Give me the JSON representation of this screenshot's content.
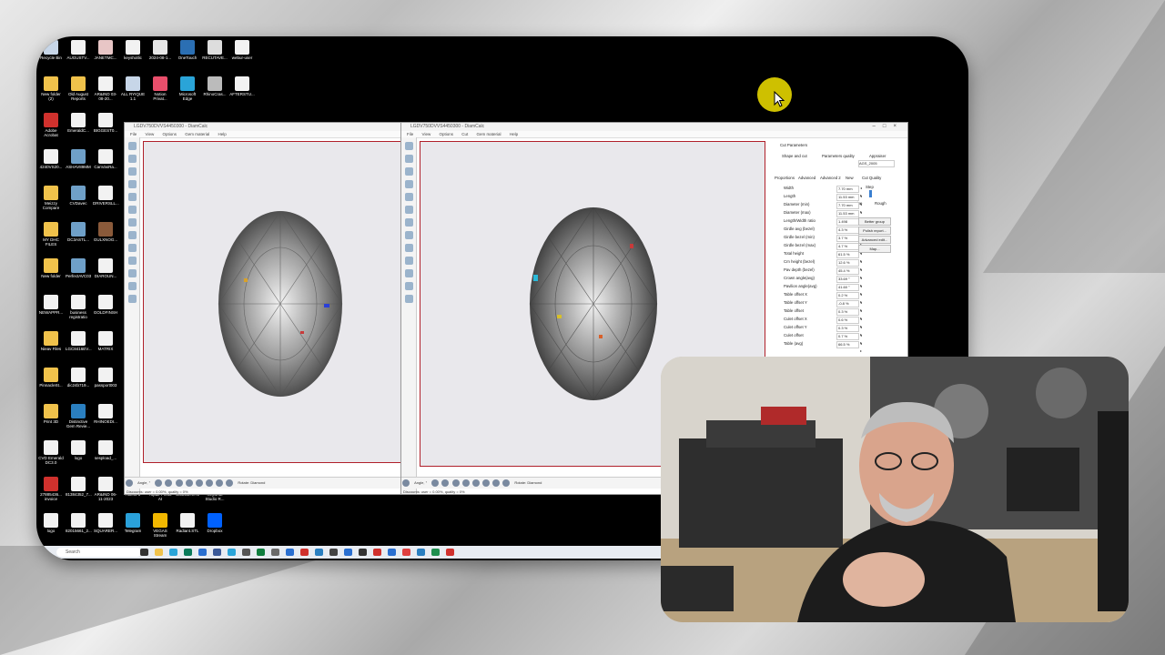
{
  "desktop_icons": [
    {
      "label": "Recycle Bin",
      "color": "#c7d6e8"
    },
    {
      "label": "AUGUSTV...",
      "color": "#f2f2f2"
    },
    {
      "label": "JANETMC...",
      "color": "#e8c6c6"
    },
    {
      "label": "keyshotlic",
      "color": "#f2f2f2"
    },
    {
      "label": "2024-08-1...",
      "color": "#e6e6e6"
    },
    {
      "label": "OneTouch",
      "color": "#2b6fb3"
    },
    {
      "label": "RECUTAVE...",
      "color": "#dddddd"
    },
    {
      "label": "webur-user",
      "color": "#f2f2f2"
    },
    {
      "label": "New folder (2)",
      "color": "#f0c24b"
    },
    {
      "label": "Old August Reports",
      "color": "#f0c24b"
    },
    {
      "label": "AR&IND 03-08-20...",
      "color": "#f2f2f2"
    },
    {
      "label": "ALL RYIQUE 1.1",
      "color": "#c7d6e8"
    },
    {
      "label": "Notion Privat...",
      "color": "#e94e6b"
    },
    {
      "label": "Microsoft Edge",
      "color": "#2aa4d8"
    },
    {
      "label": "RhinoCras...",
      "color": "#bbbbbb"
    },
    {
      "label": "AFTERSTU...",
      "color": "#f2f2f2"
    },
    {
      "label": "Adobe Acrobat",
      "color": "#d0312d"
    },
    {
      "label": "EmeraldC...",
      "color": "#f2f2f2"
    },
    {
      "label": "BIGGEST0...",
      "color": "#f2f2f2"
    },
    {
      "label": "4240VS20...",
      "color": "#f2f2f2"
    },
    {
      "label": "ASHAV89MM",
      "color": "#6fa0c8"
    },
    {
      "label": "CanVasRa...",
      "color": "#f2f2f2"
    },
    {
      "label": "Meizzy Compare",
      "color": "#f0c24b"
    },
    {
      "label": "CVDavec",
      "color": "#6fa0c8"
    },
    {
      "label": "DRIVERSLL...",
      "color": "#f2f2f2"
    },
    {
      "label": "MY DHC FILES",
      "color": "#f0c24b"
    },
    {
      "label": "DC3ASTL...",
      "color": "#6fa0c8"
    },
    {
      "label": "GULXNOG...",
      "color": "#8a5a3a"
    },
    {
      "label": "New folder",
      "color": "#f0c24b"
    },
    {
      "label": "PerfectAVC03",
      "color": "#6fa0c8"
    },
    {
      "label": "DIAROUN...",
      "color": "#f2f2f2"
    },
    {
      "label": "NEWAPPR...",
      "color": "#f2f2f2"
    },
    {
      "label": "business registratio",
      "color": "#f2f2f2"
    },
    {
      "label": "GOLDFINSH",
      "color": "#f2f2f2"
    },
    {
      "label": "Nieav Files",
      "color": "#f0c24b"
    },
    {
      "label": "LGC8416EV...",
      "color": "#f2f2f2"
    },
    {
      "label": "MATRIX",
      "color": "#f2f2f2"
    },
    {
      "label": "PinnacleSt...",
      "color": "#f0c24b"
    },
    {
      "label": "dic24b719...",
      "color": "#f2f2f2"
    },
    {
      "label": "passport003",
      "color": "#f2f2f2"
    },
    {
      "label": "Print 3D",
      "color": "#f0c24b"
    },
    {
      "label": "Distinctive Gem Revie...",
      "color": "#2a7fc0"
    },
    {
      "label": "RHINOEDI...",
      "color": "#f2f2f2"
    },
    {
      "label": "CVD Emerald DC3.0",
      "color": "#f2f2f2"
    },
    {
      "label": "logo",
      "color": "#f2f2f2"
    },
    {
      "label": "sespload_...",
      "color": "#f2f2f2"
    },
    {
      "label": "27885436... invoice",
      "color": "#d0312d"
    },
    {
      "label": "81384352_7...",
      "color": "#f2f2f2"
    },
    {
      "label": "AR&IND 06-11-2023",
      "color": "#f2f2f2"
    },
    {
      "label": "Akeno 8",
      "color": "#f2f2f2"
    },
    {
      "label": "Topaz Photo AI",
      "color": "#f2f2f2"
    },
    {
      "label": "Cushion.STL",
      "color": "#f2f2f2"
    },
    {
      "label": "KeyShot Studio R...",
      "color": "#f2f2f2"
    },
    {
      "label": "logo",
      "color": "#f2f2f2"
    },
    {
      "label": "82015661_2...",
      "color": "#f2f2f2"
    },
    {
      "label": "SQUARER...",
      "color": "#f2f2f2"
    },
    {
      "label": "Telegram",
      "color": "#2aa1da"
    },
    {
      "label": "VEGAS Stream",
      "color": "#f2b800"
    },
    {
      "label": "Radiant.STL",
      "color": "#f2f2f2"
    },
    {
      "label": "Dropbox",
      "color": "#0061fe"
    }
  ],
  "window1": {
    "title": "LGDV750DVVS4450300 - DiamCalc",
    "menu": [
      "File",
      "View",
      "Options",
      "Gem material",
      "Help"
    ],
    "angle_label": "Angle, °",
    "rotate_label": "Rotate: Diamond",
    "status": "Discounts: user = 0.00%, quality = 0%"
  },
  "window2": {
    "title": "LGDV750DVVS4450300 - DiamCalc",
    "menu": [
      "File",
      "View",
      "Options",
      "Cut",
      "Gem material",
      "Help"
    ],
    "angle_label": "Angle, °",
    "rotate_label": "Rotate: Diamond",
    "status": "Discounts: user = 0.00%, quality = 0%"
  },
  "cut_panel": {
    "header": "Cut Parameters",
    "tabs": [
      "Shape and cut",
      "Parameters quality",
      "Appraiser"
    ],
    "appraiser_value": "AGS_2005",
    "subtabs": [
      "Proportions",
      "Advanced",
      "Advanced 2",
      "New"
    ],
    "cut_quality_label": "Cut Quality",
    "cut_quality_top": "Step",
    "fine_label": "Fine",
    "rough_label": "Rough",
    "rows": [
      {
        "label": "Width",
        "value": "7.70 mm"
      },
      {
        "label": "Length",
        "value": "11.53 mm"
      },
      {
        "label": "Diameter (min)",
        "value": "7.70 mm"
      },
      {
        "label": "Diameter (max)",
        "value": "11.53 mm"
      },
      {
        "label": "Length/Width ratio",
        "value": "1.498"
      },
      {
        "label": "Girdle avg (bezel)",
        "value": "4.3 %"
      },
      {
        "label": "Girdle bezel (min)",
        "value": "3.7 %"
      },
      {
        "label": "Girdle bezel (max)",
        "value": "4.7 %"
      },
      {
        "label": "Total height",
        "value": "61.5 %"
      },
      {
        "label": "Crn height (bezel)",
        "value": "12.6 %"
      },
      {
        "label": "Pav depth (bezel)",
        "value": "45.4 %"
      },
      {
        "label": "Crown angle(avg)",
        "value": "33.69 °"
      },
      {
        "label": "Pavilion angle(avg)",
        "value": "41.60 °"
      },
      {
        "label": "Table offset X",
        "value": "0.2 %"
      },
      {
        "label": "Table offset Y",
        "value": "-0.8 %"
      },
      {
        "label": "Table offset",
        "value": "0.3 %"
      },
      {
        "label": "Culet offset X",
        "value": "0.6 %"
      },
      {
        "label": "Culet offset Y",
        "value": "0.3 %"
      },
      {
        "label": "Culet offset",
        "value": "0.7 %"
      },
      {
        "label": "Table (avg)",
        "value": "66.5 %"
      }
    ],
    "buttons": [
      "Better group",
      "Polish report...",
      "Advanced edit...",
      "Map..."
    ]
  },
  "taskbar": {
    "search_placeholder": "Search"
  }
}
